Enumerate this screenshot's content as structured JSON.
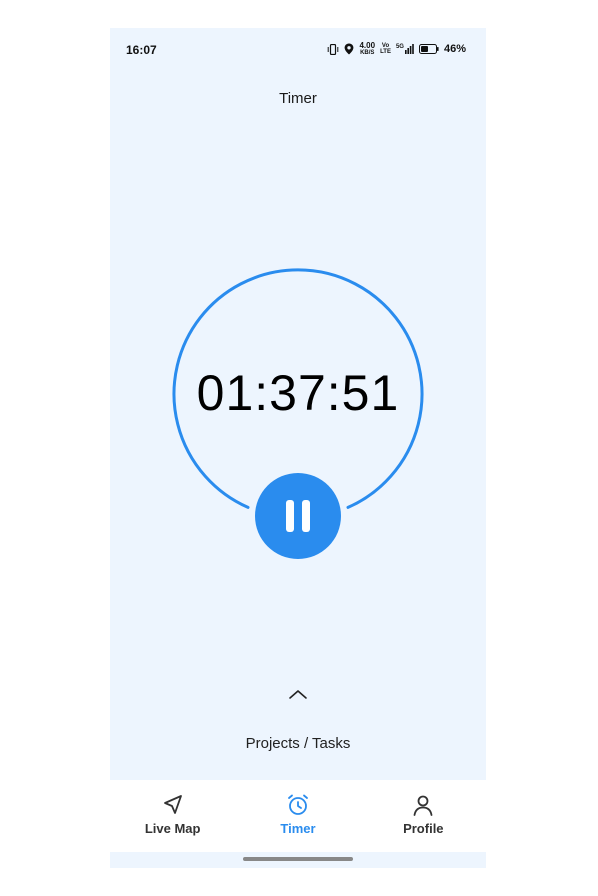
{
  "status_bar": {
    "time": "16:07",
    "speed_value": "4.00",
    "speed_unit": "KB/S",
    "volte_top": "Vo",
    "volte_bottom": "LTE",
    "network": "5G",
    "battery_percent": "46%"
  },
  "header": {
    "title": "Timer"
  },
  "timer": {
    "elapsed": "01:37:51",
    "state": "running",
    "accent_color": "#2a8cee"
  },
  "projects": {
    "label": "Projects / Tasks"
  },
  "bottom_nav": {
    "active_index": 1,
    "items": [
      {
        "label": "Live Map",
        "icon": "navigation-arrow-icon"
      },
      {
        "label": "Timer",
        "icon": "alarm-clock-icon"
      },
      {
        "label": "Profile",
        "icon": "person-icon"
      }
    ]
  }
}
